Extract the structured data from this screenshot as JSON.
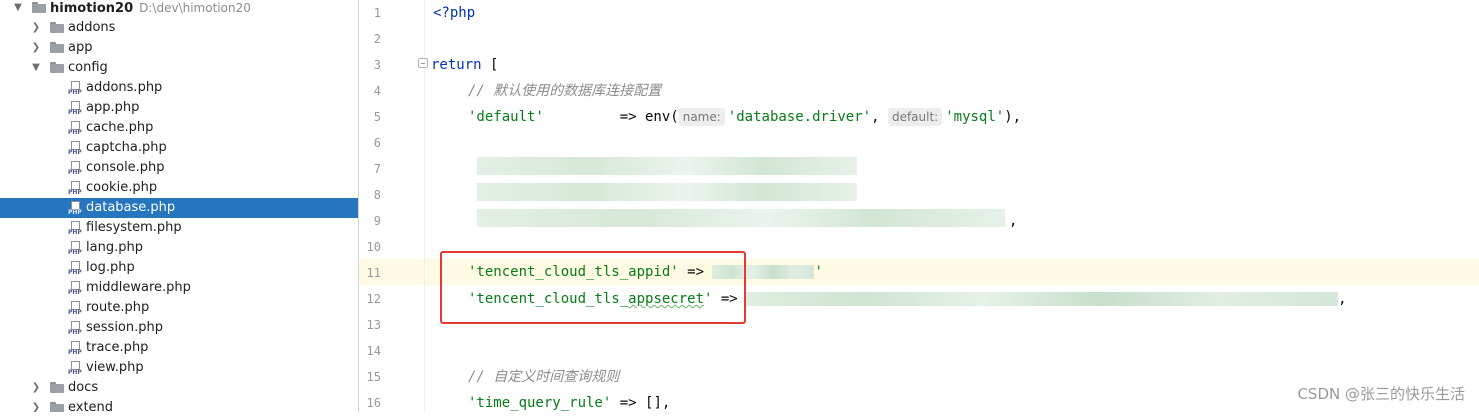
{
  "project_tree": {
    "root": {
      "name": "himotion20",
      "path": "D:\\dev\\himotion20"
    },
    "items": [
      {
        "type": "folder",
        "name": "addons",
        "expanded": false
      },
      {
        "type": "folder",
        "name": "app",
        "expanded": false
      },
      {
        "type": "folder",
        "name": "config",
        "expanded": true
      },
      {
        "type": "file",
        "name": "addons.php"
      },
      {
        "type": "file",
        "name": "app.php"
      },
      {
        "type": "file",
        "name": "cache.php"
      },
      {
        "type": "file",
        "name": "captcha.php"
      },
      {
        "type": "file",
        "name": "console.php"
      },
      {
        "type": "file",
        "name": "cookie.php"
      },
      {
        "type": "file",
        "name": "database.php",
        "selected": true
      },
      {
        "type": "file",
        "name": "filesystem.php"
      },
      {
        "type": "file",
        "name": "lang.php"
      },
      {
        "type": "file",
        "name": "log.php"
      },
      {
        "type": "file",
        "name": "middleware.php"
      },
      {
        "type": "file",
        "name": "route.php"
      },
      {
        "type": "file",
        "name": "session.php"
      },
      {
        "type": "file",
        "name": "trace.php"
      },
      {
        "type": "file",
        "name": "view.php"
      },
      {
        "type": "folder",
        "name": "docs",
        "expanded": false
      },
      {
        "type": "folder",
        "name": "extend",
        "expanded": false
      }
    ],
    "file_icon_text": "PHP"
  },
  "editor": {
    "line_numbers": [
      "1",
      "2",
      "3",
      "4",
      "5",
      "6",
      "7",
      "8",
      "9",
      "10",
      "11",
      "12",
      "13",
      "14",
      "15",
      "16"
    ],
    "highlighted_line": "11",
    "code": {
      "l1": "<?php",
      "l3_kw": "return",
      "l3_rest": " [",
      "l4": "// 默认使用的数据库连接配置",
      "l5_key": "'default'",
      "l5_arrow": "         => env(",
      "l5_hint1": "name:",
      "l5_val1": "'database.driver'",
      "l5_sep": ", ",
      "l5_hint2": "default:",
      "l5_val2": "'mysql'",
      "l5_end": "),",
      "l9_end": ",",
      "l11_key": "'tencent_cloud_tls_appid'",
      "l11_arrow": " => ",
      "l11_end": "'",
      "l12_key_a": "'tencent_cloud_tls_",
      "l12_key_b": "appsecret",
      "l12_key_c": "'",
      "l12_arrow": " => ",
      "l12_end": ",",
      "l15": "// 自定义时间查询规则",
      "l16_key": "'time_query_rule'",
      "l16_rest": " => [],"
    }
  },
  "watermark": "CSDN @张三的快乐生活",
  "colors": {
    "selection": "#2675bf",
    "annotation_box": "#e53935",
    "string": "#067d17",
    "keyword": "#0033b3"
  }
}
